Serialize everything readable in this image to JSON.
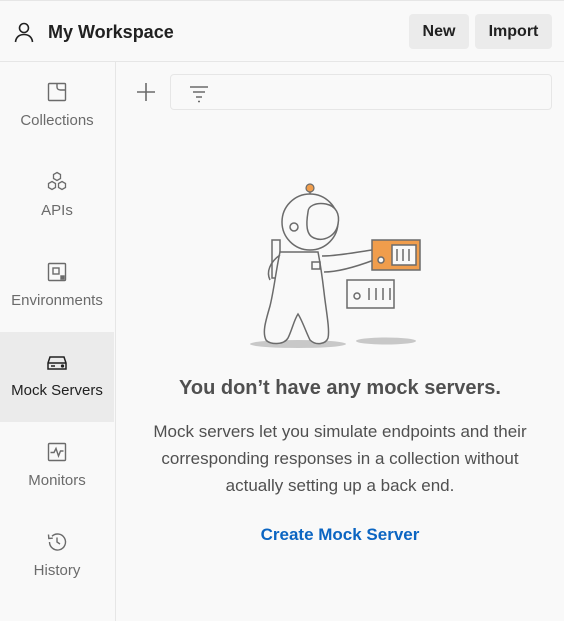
{
  "header": {
    "workspace_icon": "user-icon",
    "title": "My Workspace",
    "new_label": "New",
    "import_label": "Import"
  },
  "sidebar": {
    "items": [
      {
        "label": "Collections",
        "icon": "collections-icon",
        "active": false
      },
      {
        "label": "APIs",
        "icon": "apis-icon",
        "active": false
      },
      {
        "label": "Environments",
        "icon": "environments-icon",
        "active": false
      },
      {
        "label": "Mock Servers",
        "icon": "mock-servers-icon",
        "active": true
      },
      {
        "label": "Monitors",
        "icon": "monitors-icon",
        "active": false
      },
      {
        "label": "History",
        "icon": "history-icon",
        "active": false
      }
    ]
  },
  "toolbar": {
    "add_icon": "plus-icon",
    "filter_icon": "filter-icon"
  },
  "empty_state": {
    "title": "You don’t have any mock servers.",
    "description": "Mock servers let you simulate endpoints and their corresponding responses in a collection without actually setting up a back end.",
    "action_label": "Create Mock Server"
  },
  "colors": {
    "accent_link": "#0b65c2",
    "orange": "#f09d4c",
    "active_bg": "#ebebeb"
  }
}
